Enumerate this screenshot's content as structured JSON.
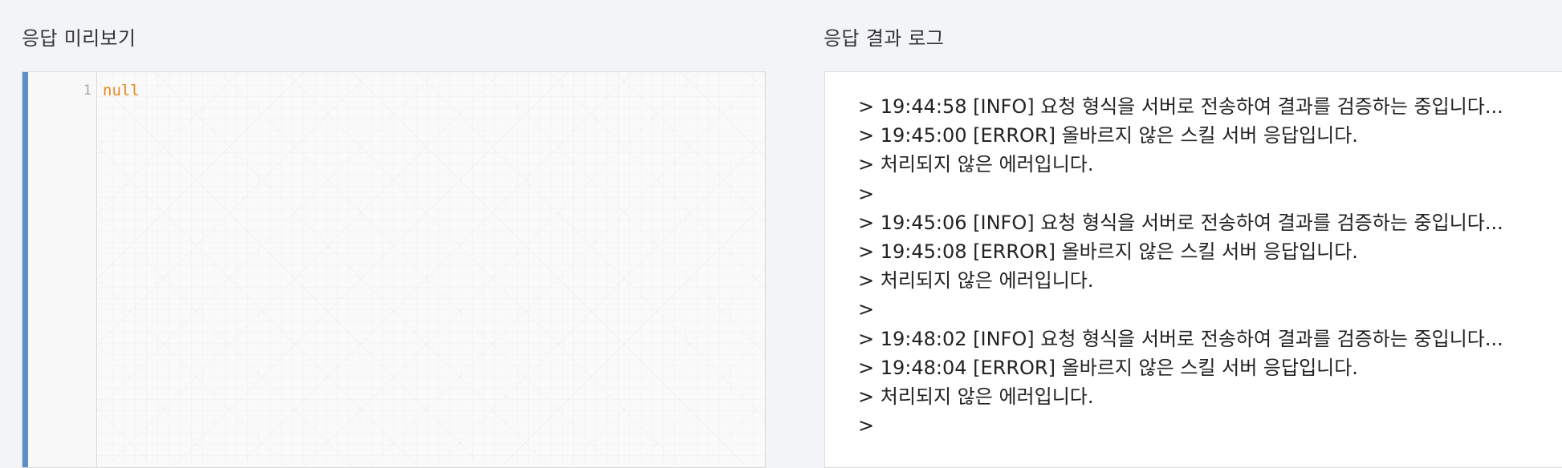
{
  "preview": {
    "title": "응답 미리보기",
    "line_number": "1",
    "code": "null",
    "accent_color": "#5b8fc9",
    "code_color": "#e8891c"
  },
  "log": {
    "title": "응답 결과 로그",
    "lines": [
      "> 19:44:58 [INFO] 요청 형식을 서버로 전송하여 결과를 검증하는 중입니다...",
      "> 19:45:00 [ERROR] 올바르지 않은 스킬 서버 응답입니다.",
      "> 처리되지 않은 에러입니다.",
      ">",
      "> 19:45:06 [INFO] 요청 형식을 서버로 전송하여 결과를 검증하는 중입니다...",
      "> 19:45:08 [ERROR] 올바르지 않은 스킬 서버 응답입니다.",
      "> 처리되지 않은 에러입니다.",
      ">",
      "> 19:48:02 [INFO] 요청 형식을 서버로 전송하여 결과를 검증하는 중입니다...",
      "> 19:48:04 [ERROR] 올바르지 않은 스킬 서버 응답입니다.",
      "> 처리되지 않은 에러입니다.",
      ">"
    ]
  }
}
